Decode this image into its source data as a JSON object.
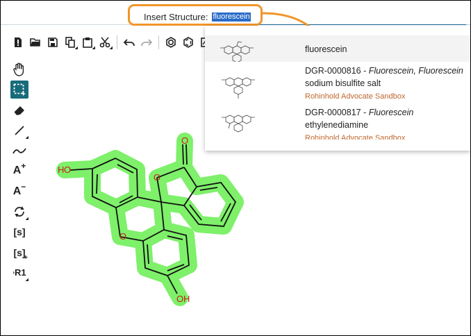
{
  "insert": {
    "label": "Insert Structure:",
    "value": "fluorescein"
  },
  "toolbar": {
    "buttons": [
      "new-file-icon",
      "open-folder-icon",
      "save-icon",
      "copy-icon",
      "paste-icon",
      "cut-icon",
      "undo-icon",
      "redo-icon",
      "aromatize-icon",
      "dearomatize-icon",
      "clean-icon"
    ]
  },
  "sidebar": {
    "tools": [
      "hand-icon",
      "rectangle-select-icon",
      "eraser-icon",
      "single-bond-icon",
      "chain-icon",
      "charge-plus-icon",
      "charge-minus-icon",
      "rotate-icon",
      "sgroup-icon",
      "sgroup-add-icon",
      "rgroup-icon"
    ],
    "labels": {
      "charge_plus": "A",
      "charge_minus": "A",
      "sgroup": "[s]",
      "sgroup_add": "[s]",
      "rgroup": "R1"
    }
  },
  "results": [
    {
      "name": "fluorescein"
    },
    {
      "id": "DGR-0000816",
      "sep": " - ",
      "synonyms": "Fluorescein, Fluorescein",
      "name_rest": "sodium bisulfite salt",
      "source": "Rohinhold Advocate Sandbox"
    },
    {
      "id": "DGR-0000817",
      "sep": " - ",
      "synonyms": "Fluorescein",
      "name_rest": "ethylenediamine",
      "source": "Rohinhold Advocate Sandbox"
    }
  ],
  "molecule": {
    "atoms": {
      "o1": "O",
      "o2": "O",
      "o3": "O",
      "ho_left_h": "H",
      "ho_left_o": "O",
      "oh_bottom_o": "O",
      "oh_bottom_h": "H"
    },
    "highlight_color": "#7ef06a",
    "heteroatom_color": "#cc1a1a"
  },
  "colors": {
    "callout": "#f0962b",
    "active_tool": "#176b7a",
    "selection": "#2a6cc8",
    "source_link": "#c0672e"
  }
}
